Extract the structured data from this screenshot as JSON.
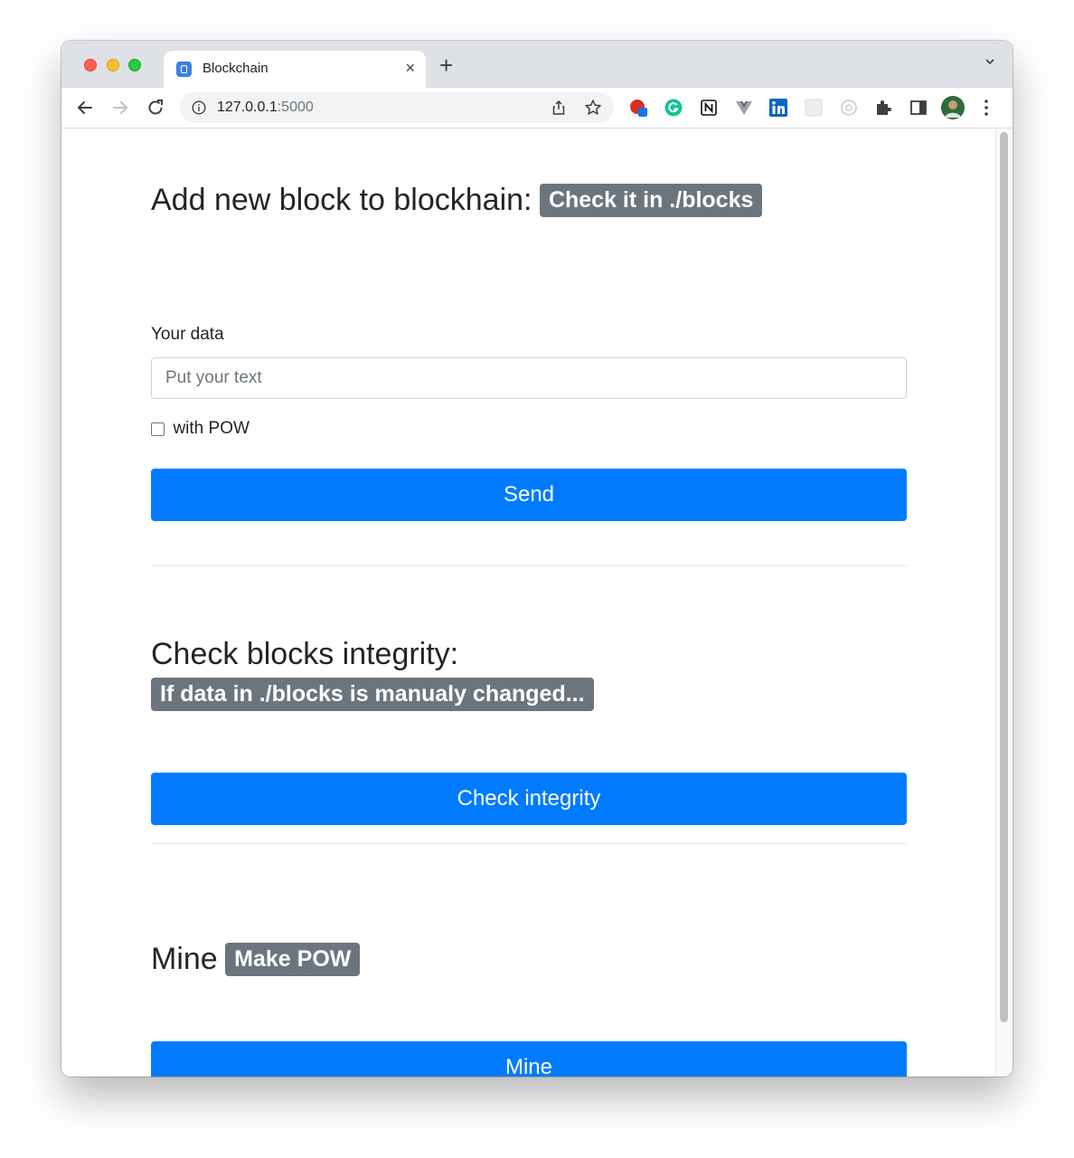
{
  "browser": {
    "tab_title": "Blockchain",
    "tab_close": "×",
    "new_tab": "+",
    "url_host": "127.0.0.1",
    "url_port": ":5000"
  },
  "extensions": [
    "adblock-icon",
    "grammarly-icon",
    "notion-icon",
    "vue-devtools-icon",
    "linkedin-icon",
    "blank-extension-icon",
    "react-devtools-icon",
    "puzzle-icon",
    "sidepanel-icon",
    "profile-avatar"
  ],
  "colors": {
    "primary": "#007bff",
    "badge": "#6c757d",
    "text": "#212529"
  },
  "add_block": {
    "heading": "Add new block to blockhain:",
    "badge": "Check it in ./blocks",
    "data_label": "Your data",
    "data_placeholder": "Put your text",
    "pow_label": "with POW",
    "send_label": "Send"
  },
  "integrity": {
    "heading": "Check blocks integrity:",
    "badge": "If data in ./blocks is manualy changed...",
    "button_label": "Check integrity"
  },
  "mine": {
    "heading": "Mine",
    "badge": "Make POW",
    "button_label": "Mine"
  }
}
